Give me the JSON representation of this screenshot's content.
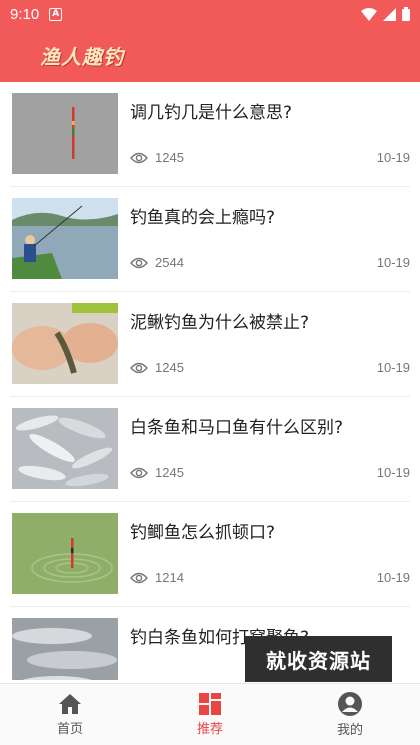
{
  "status_bar": {
    "time": "9:10",
    "notification_icon_letter": "A"
  },
  "app": {
    "title": "渔人趣钓",
    "accent_color": "#f25a5a"
  },
  "articles": [
    {
      "title": "调几钓几是什么意思?",
      "views": "1245",
      "date": "10-19",
      "thumbnail": "float-grey-background"
    },
    {
      "title": "钓鱼真的会上瘾吗?",
      "views": "2544",
      "date": "10-19",
      "thumbnail": "angler-by-lake"
    },
    {
      "title": "泥鳅钓鱼为什么被禁止?",
      "views": "1245",
      "date": "10-19",
      "thumbnail": "loach-in-hands"
    },
    {
      "title": "白条鱼和马口鱼有什么区别?",
      "views": "1245",
      "date": "10-19",
      "thumbnail": "pile-of-small-fish"
    },
    {
      "title": "钓鲫鱼怎么抓顿口?",
      "views": "1214",
      "date": "10-19",
      "thumbnail": "float-ripples-green-water"
    },
    {
      "title": "钓白条鱼如何打窝聚鱼?",
      "views": "",
      "date": "",
      "thumbnail": "silver-fish-closeup"
    }
  ],
  "watermark": {
    "text": "就收资源站"
  },
  "bottom_nav": {
    "items": [
      {
        "label": "首页",
        "icon": "home-icon",
        "active": false
      },
      {
        "label": "推荐",
        "icon": "grid-icon",
        "active": true
      },
      {
        "label": "我的",
        "icon": "user-icon",
        "active": false
      }
    ],
    "active_color": "#e94545"
  }
}
